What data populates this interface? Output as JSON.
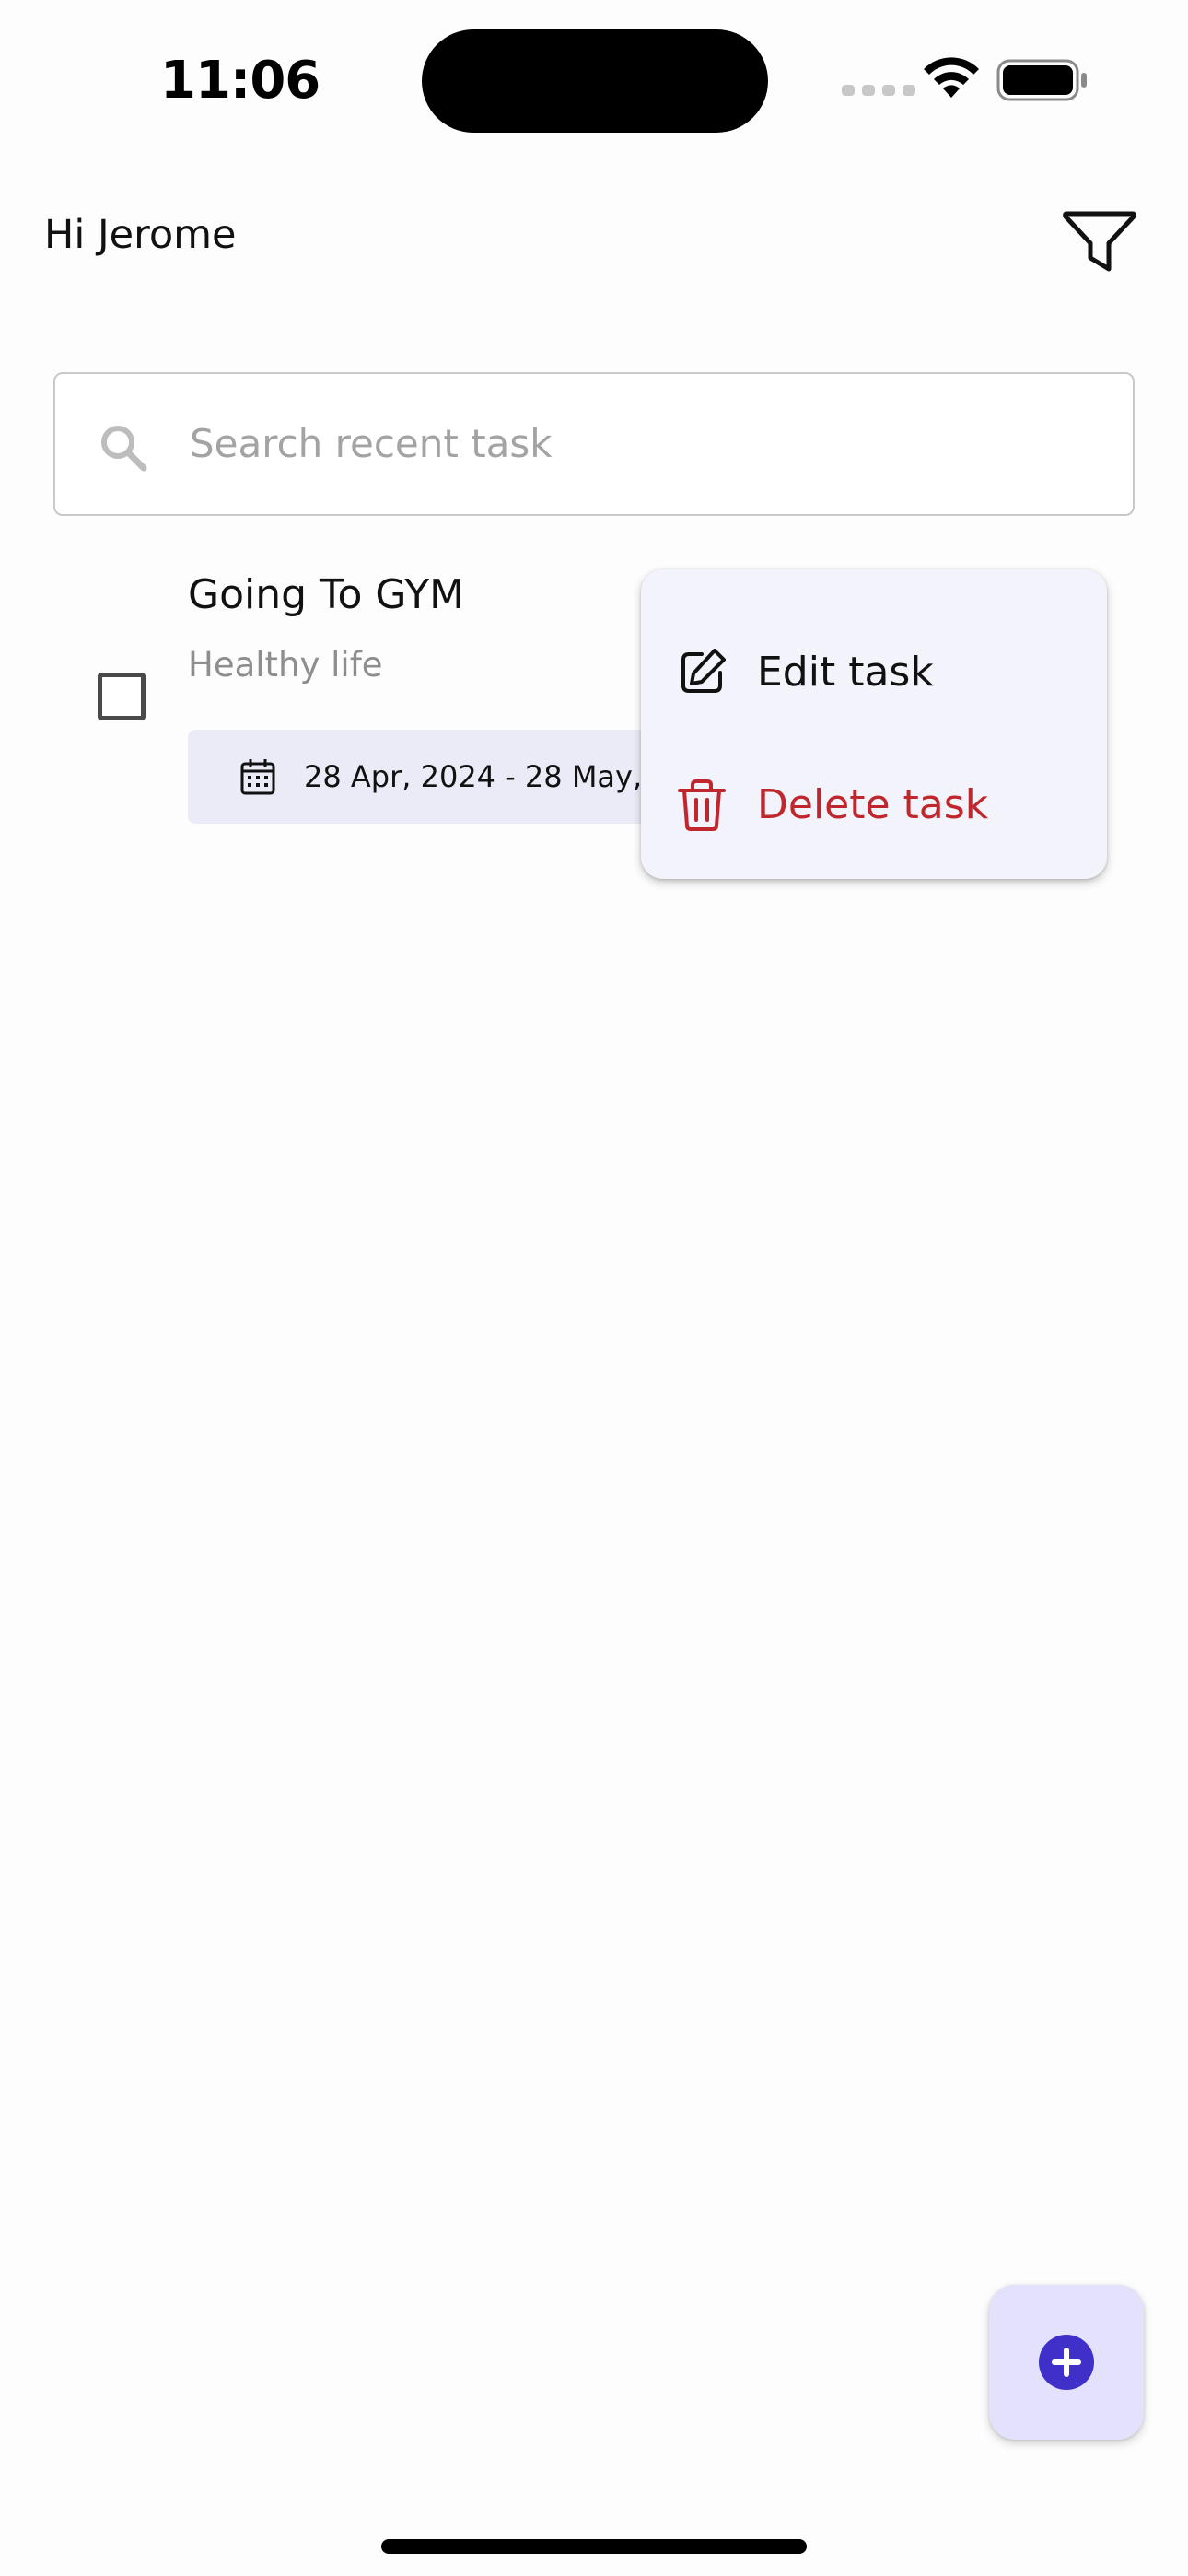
{
  "status_bar": {
    "time": "11:06"
  },
  "header": {
    "greeting": "Hi Jerome",
    "filter_icon": "filter-icon"
  },
  "search": {
    "placeholder": "Search recent task",
    "icon": "search-icon"
  },
  "tasks": [
    {
      "title": "Going To GYM",
      "subtitle": "Healthy life",
      "date_range": "28 Apr, 2024 - 28 May, 2",
      "checked": false
    }
  ],
  "context_menu": {
    "edit_label": "Edit task",
    "edit_icon": "edit-icon",
    "delete_label": "Delete task",
    "delete_icon": "trash-icon"
  },
  "fab": {
    "icon": "plus-circle-icon"
  },
  "colors": {
    "accent": "#3f30c9",
    "danger": "#c0272d",
    "chip_bg": "#ebebf7",
    "menu_bg": "#f3f3fb",
    "fab_bg": "#e3e1fb"
  }
}
